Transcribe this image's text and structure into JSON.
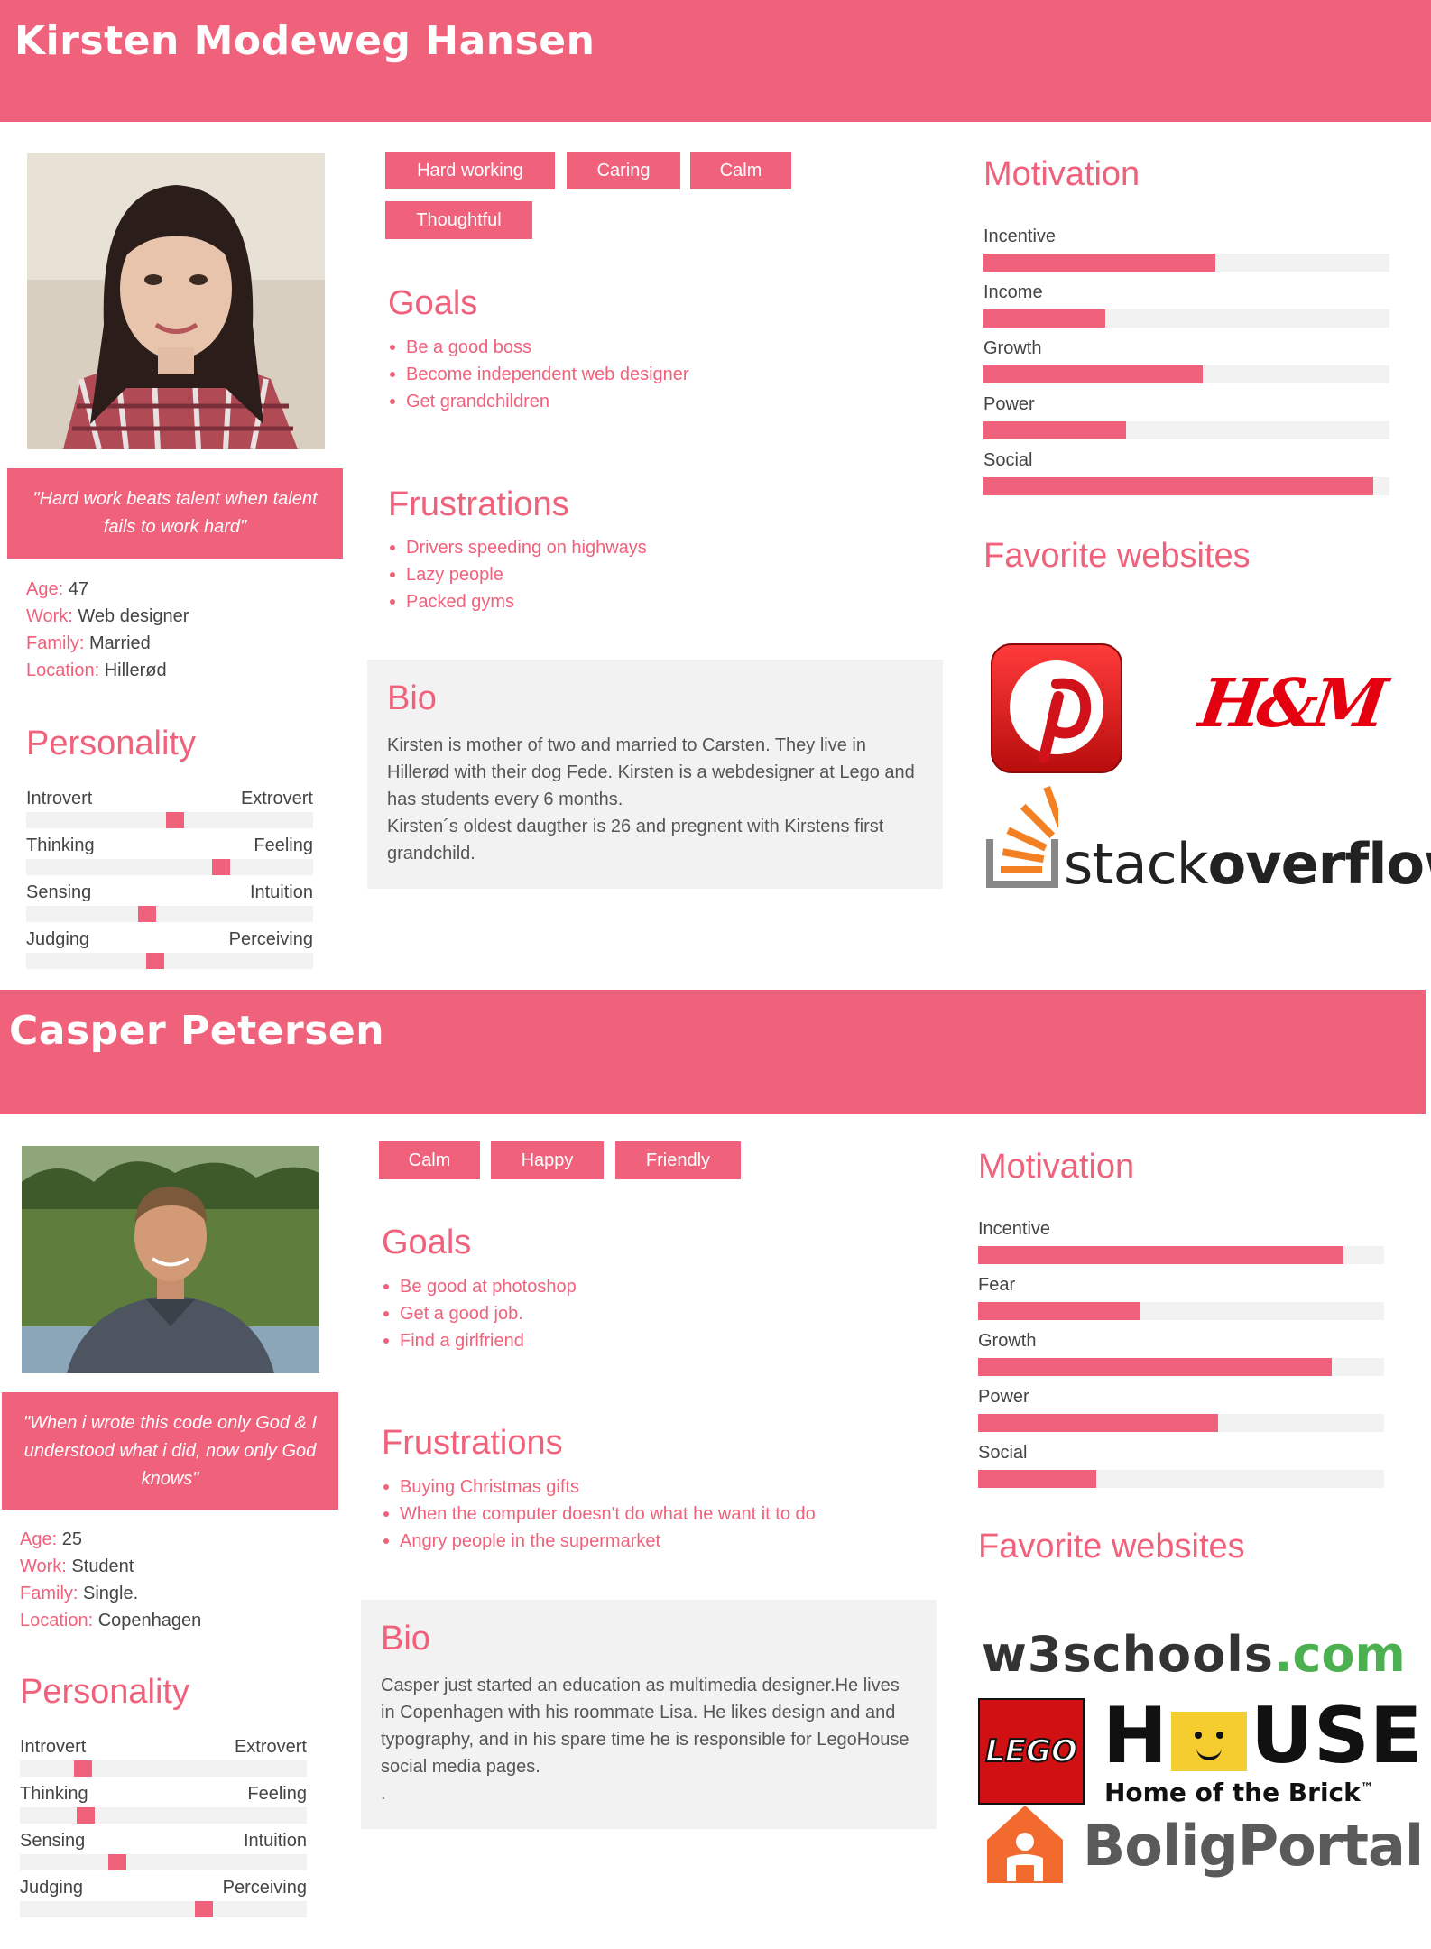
{
  "personas": [
    {
      "name": "Kirsten Modeweg Hansen",
      "traits": [
        "Hard working",
        "Caring",
        "Calm",
        "Thoughtful"
      ],
      "quote": "\"Hard work beats talent when talent fails to work hard\"",
      "facts": [
        {
          "key": "Age:",
          "value": " 47"
        },
        {
          "key": "Work:",
          "value": " Web designer"
        },
        {
          "key": "Family:",
          "value": " Married"
        },
        {
          "key": "Location:",
          "value": " Hillerød"
        }
      ],
      "goals_title": "Goals",
      "goals": [
        "Be a good boss",
        "Become independent web designer",
        "Get grandchildren"
      ],
      "frustrations_title": "Frustrations",
      "frustrations": [
        "Drivers speeding on highways",
        "Lazy people",
        "Packed gyms"
      ],
      "bio_title": "Bio",
      "bio": "Kirsten is mother of two and married to Carsten. They live in Hillerød with their dog Fede. Kirsten is a webdesigner at Lego and has students every 6 months.\nKirsten´s oldest daugther is 26 and pregnent with Kirstens first grandchild.",
      "personality_title": "Personality",
      "personality": [
        {
          "left": "Introvert",
          "right": "Extrovert",
          "value": 0.52
        },
        {
          "left": "Thinking",
          "right": "Feeling",
          "value": 0.68
        },
        {
          "left": "Sensing",
          "right": "Intuition",
          "value": 0.42
        },
        {
          "left": "Judging",
          "right": "Perceiving",
          "value": 0.45
        }
      ],
      "motivation_title": "Motivation",
      "motivation": [
        {
          "label": "Incentive",
          "value": 0.57
        },
        {
          "label": "Income",
          "value": 0.3
        },
        {
          "label": "Growth",
          "value": 0.54
        },
        {
          "label": "Power",
          "value": 0.35
        },
        {
          "label": "Social",
          "value": 0.96
        }
      ],
      "websites_title": "Favorite websites",
      "websites": [
        "pinterest-logo",
        "hm-logo",
        "stackoverflow-logo"
      ],
      "logo_text": {
        "hm": "H&M",
        "so_light": "stack",
        "so_bold": "overflow"
      }
    },
    {
      "name": "Casper Petersen",
      "traits": [
        "Calm",
        "Happy",
        "Friendly"
      ],
      "quote": "\"When i wrote this code only God & I understood what i did, now only God knows\"",
      "facts": [
        {
          "key": "Age:",
          "value": " 25"
        },
        {
          "key": "Work:",
          "value": " Student"
        },
        {
          "key": "Family:",
          "value": " Single."
        },
        {
          "key": "Location:",
          "value": " Copenhagen"
        }
      ],
      "goals_title": "Goals",
      "goals": [
        "Be good at photoshop",
        "Get a good job.",
        "Find a girlfriend"
      ],
      "frustrations_title": "Frustrations",
      "frustrations": [
        "Buying Christmas gifts",
        "When the computer doesn't do what he want it to do",
        "Angry people in the supermarket"
      ],
      "bio_title": "Bio",
      "bio": "Casper just started an education as multimedia designer.He lives in Copenhagen with his roommate Lisa. He likes design and and typography, and in his spare time he is responsible for LegoHouse social media pages.\n.",
      "personality_title": "Personality",
      "personality": [
        {
          "left": "Introvert",
          "right": "Extrovert",
          "value": 0.22
        },
        {
          "left": "Thinking",
          "right": "Feeling",
          "value": 0.23
        },
        {
          "left": "Sensing",
          "right": "Intuition",
          "value": 0.34
        },
        {
          "left": "Judging",
          "right": "Perceiving",
          "value": 0.64
        }
      ],
      "motivation_title": "Motivation",
      "motivation": [
        {
          "label": "Incentive",
          "value": 0.9
        },
        {
          "label": "Fear",
          "value": 0.4
        },
        {
          "label": "Growth",
          "value": 0.87
        },
        {
          "label": "Power",
          "value": 0.59
        },
        {
          "label": "Social",
          "value": 0.29
        }
      ],
      "websites_title": "Favorite websites",
      "websites": [
        "w3schools-logo",
        "lego-house-logo",
        "boligportal-logo"
      ],
      "logo_text": {
        "w3": "w3schools",
        "w3_tld": ".com",
        "lego": "LEGO",
        "house_h": "H",
        "house_use": "USE",
        "house_sub": "Home of the Brick",
        "tm": "™",
        "bolig": "BoligPortal"
      }
    }
  ],
  "colors": {
    "accent": "#f0617b",
    "panel": "#f2f2f2",
    "w3green": "#4caf50"
  }
}
